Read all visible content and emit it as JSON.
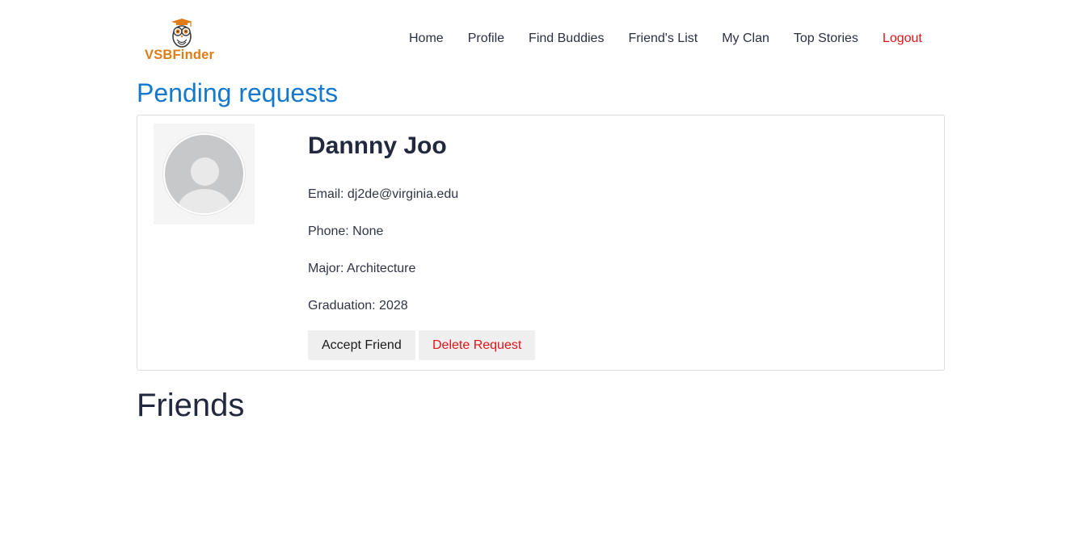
{
  "brand": {
    "name": "VSBFinder",
    "accent": "#e07b15"
  },
  "nav": {
    "items": [
      {
        "label": "Home"
      },
      {
        "label": "Profile"
      },
      {
        "label": "Find Buddies"
      },
      {
        "label": "Friend's List"
      },
      {
        "label": "My Clan"
      },
      {
        "label": "Top Stories"
      },
      {
        "label": "Logout"
      }
    ]
  },
  "pending": {
    "title": "Pending requests",
    "title_color": "#1478cc",
    "requests": [
      {
        "name": "Dannny Joo",
        "email": "Email: dj2de@virginia.edu",
        "phone": "Phone: None",
        "major": "Major: Architecture",
        "graduation": "Graduation: 2028",
        "avatar_icon": "default-user-avatar",
        "accept_label": "Accept Friend",
        "delete_label": "Delete Request"
      }
    ]
  },
  "friends": {
    "title": "Friends"
  },
  "colors": {
    "danger": "#e0151b",
    "text_dark": "#22283e"
  }
}
